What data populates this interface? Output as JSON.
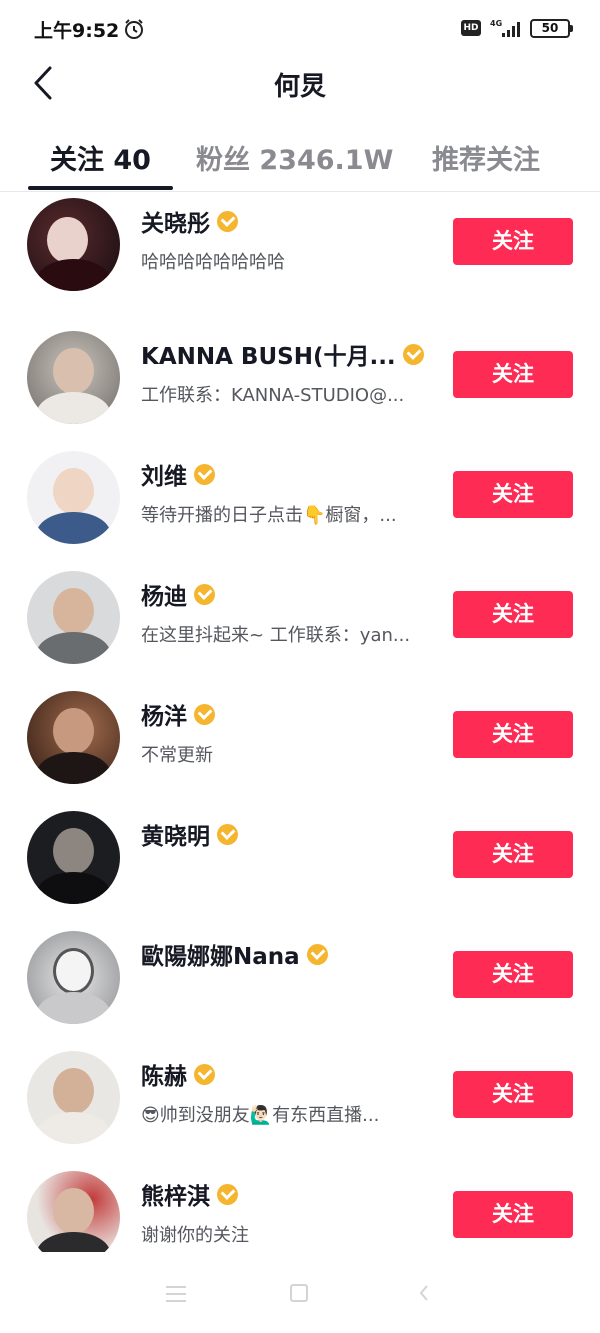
{
  "status_bar": {
    "time": "上午9:52",
    "hd_label": "HD",
    "network_label": "4G",
    "battery": "50"
  },
  "header": {
    "title": "何炅"
  },
  "tabs": [
    {
      "label": "关注 40",
      "active": true
    },
    {
      "label": "粉丝 2346.1W",
      "active": false
    },
    {
      "label": "推荐关注",
      "active": false
    }
  ],
  "follow_button_label": "关注",
  "accent_color": "#fe2c55",
  "verified_color": "#f5b52e",
  "users": [
    {
      "name": "关晓彤",
      "bio": "哈哈哈哈哈哈哈哈",
      "verified": true
    },
    {
      "name": "KANNA BUSH(十月...",
      "bio": "工作联系：KANNA-STUDIO@...",
      "verified": true
    },
    {
      "name": "刘维",
      "bio": "等待开播的日子点击👇橱窗，...",
      "verified": true
    },
    {
      "name": "杨迪",
      "bio": "在这里抖起来~ 工作联系：yan...",
      "verified": true
    },
    {
      "name": "杨洋",
      "bio": "不常更新",
      "verified": true
    },
    {
      "name": "黄晓明",
      "bio": "",
      "verified": true
    },
    {
      "name": "歐陽娜娜Nana",
      "bio": "",
      "verified": true
    },
    {
      "name": "陈赫",
      "bio": "😎帅到没朋友🙋🏻‍♂️有东西直播...",
      "verified": true
    },
    {
      "name": "熊梓淇",
      "bio": "谢谢你的关注",
      "verified": true
    }
  ]
}
